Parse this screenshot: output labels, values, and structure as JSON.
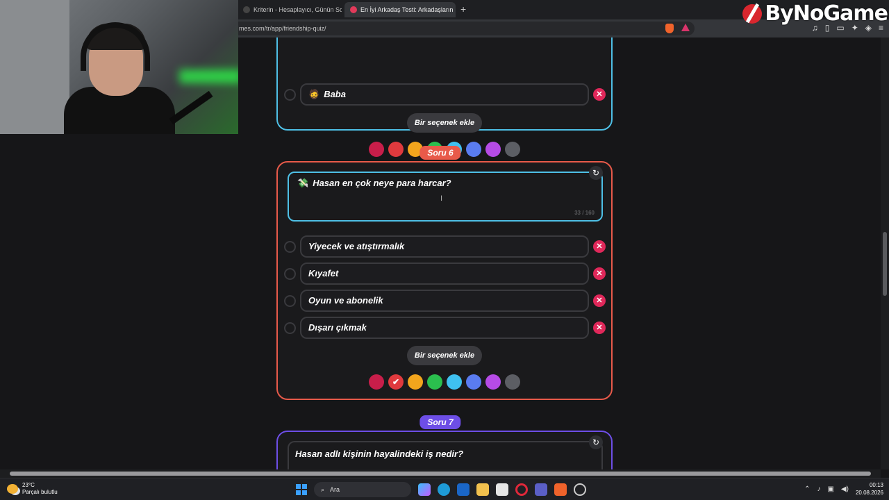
{
  "browser": {
    "tabs": [
      {
        "label": "Kriterin - Hesaplayıcı, Günün Sorusu"
      },
      {
        "label": "En İyi Arkadaş Testi: Arkadaşların",
        "close": "✕"
      }
    ],
    "new_tab": "+",
    "url": "mes.com/tr/app/friendship-quiz/"
  },
  "watermark": {
    "brand": "ByNoGame"
  },
  "page": {
    "question5": {
      "options": [
        {
          "emoji": "🧔",
          "label": "Baba"
        }
      ],
      "add_option": "Bir seçenek ekle",
      "colors": [
        "#c81e4a",
        "#e03a3e",
        "#f2a51d",
        "#2bbf4e",
        "#3fc0f0",
        "#5a7cf0",
        "#b64be6",
        "#5c5e64"
      ],
      "selected_color_index": 4
    },
    "question6": {
      "label": "Soru 6",
      "emoji": "💸",
      "text": "Hasan en çok neye para harcar?",
      "counter": "33 / 160",
      "options": [
        {
          "label": "Yiyecek ve atıştırmalık"
        },
        {
          "label": "Kıyafet"
        },
        {
          "label": "Oyun ve abonelik"
        },
        {
          "label": "Dışarı çıkmak"
        }
      ],
      "add_option": "Bir seçenek ekle",
      "colors": [
        "#c81e4a",
        "#e03a3e",
        "#f2a51d",
        "#2bbf4e",
        "#3fc0f0",
        "#5a7cf0",
        "#b64be6",
        "#5c5e64"
      ],
      "selected_color_index": 1
    },
    "question7": {
      "label": "Soru 7",
      "text": "Hasan adlı kişinin hayalindeki iş nedir?"
    },
    "check": "✔",
    "delete": "✕",
    "refresh": "↻"
  },
  "taskbar": {
    "weather_temp": "23°C",
    "weather_desc": "Parçalı bulutlu",
    "search": "Ara",
    "time": "00:13",
    "date": "20.08.2026"
  }
}
